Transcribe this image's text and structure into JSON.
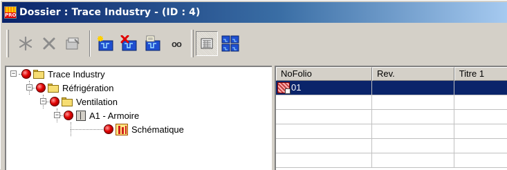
{
  "window": {
    "title": "Dossier : Trace Industry - (ID : 4)",
    "app_badge": "PRO"
  },
  "toolbar": {
    "buttons": [
      {
        "name": "new-item-button",
        "icon": "asterisk-icon"
      },
      {
        "name": "delete-button",
        "icon": "cross-icon"
      },
      {
        "name": "properties-button",
        "icon": "properties-icon"
      },
      {
        "name": "add-schematic-button",
        "icon": "add-schematic-icon"
      },
      {
        "name": "remove-schematic-button",
        "icon": "remove-schematic-icon"
      },
      {
        "name": "edit-schematic-button",
        "icon": "edit-schematic-icon"
      },
      {
        "name": "view-button",
        "icon": "glasses-icon",
        "label": "oo"
      },
      {
        "name": "list-view-button",
        "icon": "list-view-icon",
        "pressed": true
      },
      {
        "name": "grid-view-button",
        "icon": "grid-view-icon"
      }
    ]
  },
  "tree": {
    "nodes": [
      {
        "label": "Trace Industry",
        "level": 0,
        "expander": "−",
        "icon": "folder-icon"
      },
      {
        "label": "Réfrigération",
        "level": 1,
        "expander": "−",
        "icon": "folder-icon"
      },
      {
        "label": "Ventilation",
        "level": 2,
        "expander": "−",
        "icon": "folder-icon"
      },
      {
        "label": "A1 - Armoire",
        "level": 3,
        "expander": "−",
        "icon": "cabinet-icon"
      },
      {
        "label": "Schématique",
        "level": 4,
        "expander": "",
        "icon": "schematic-icon"
      }
    ]
  },
  "grid": {
    "columns": [
      "NoFolio",
      "Rev.",
      "Titre 1"
    ],
    "rows": [
      {
        "cells": [
          "01",
          "",
          ""
        ],
        "selected": true
      },
      {
        "cells": [
          "",
          "",
          ""
        ],
        "selected": false
      },
      {
        "cells": [
          "",
          "",
          ""
        ],
        "selected": false
      },
      {
        "cells": [
          "",
          "",
          ""
        ],
        "selected": false
      },
      {
        "cells": [
          "",
          "",
          ""
        ],
        "selected": false
      },
      {
        "cells": [
          "",
          "",
          ""
        ],
        "selected": false
      }
    ]
  },
  "colors": {
    "title_gradient_start": "#0a246a",
    "title_gradient_end": "#a6caf0",
    "selection": "#0a246a",
    "node_status": "#e00000"
  }
}
